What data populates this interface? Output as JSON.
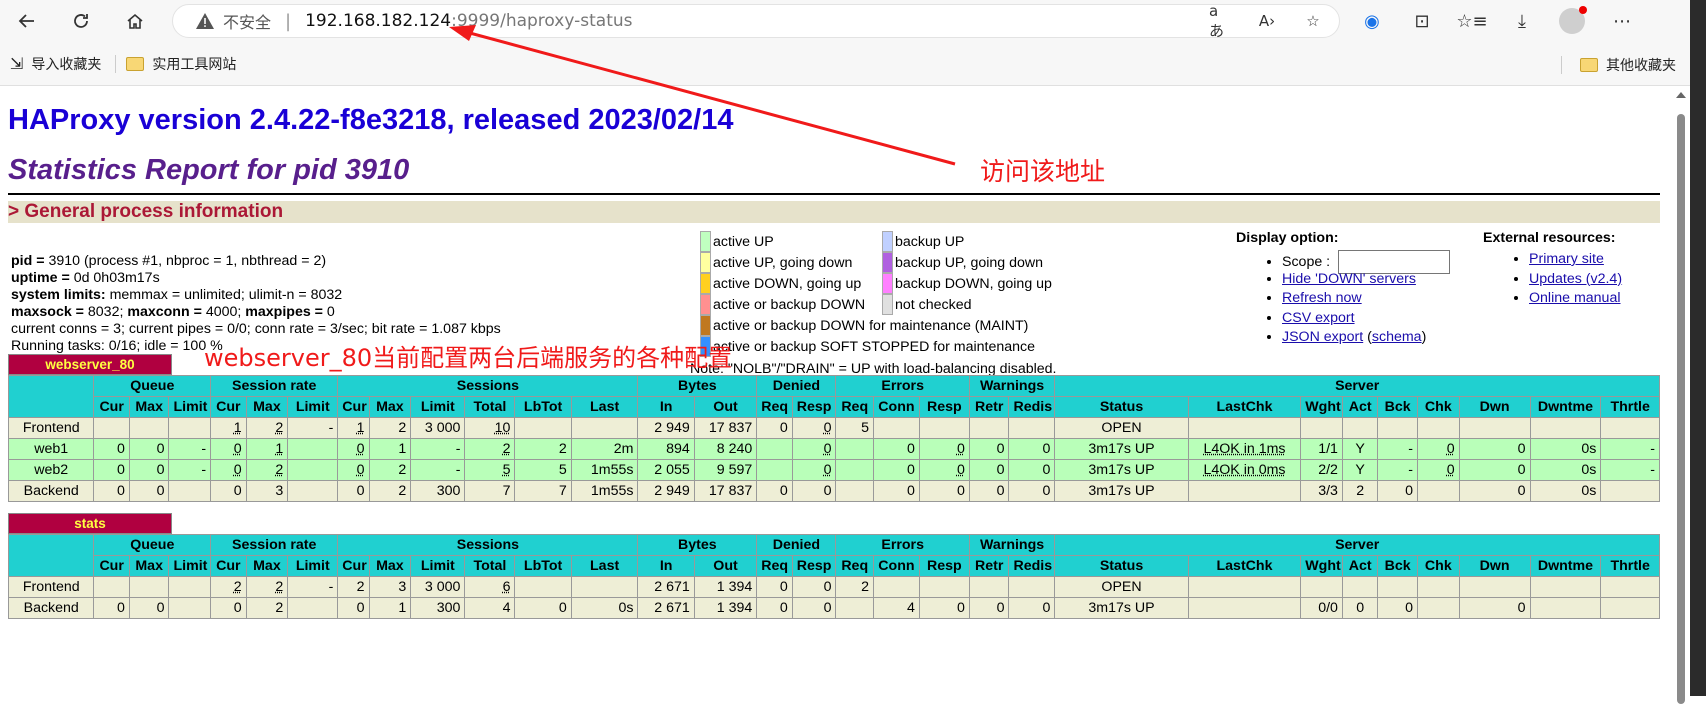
{
  "browser": {
    "insecure_label": "不安全",
    "url_host": "192.168.182.124",
    "url_rest": ":9999/haproxy-status",
    "bookmarks": [
      {
        "label": "导入收藏夹"
      },
      {
        "label": "实用工具网站"
      }
    ],
    "other_bookmarks": "其他收藏夹"
  },
  "page": {
    "title": "HAProxy version 2.4.22-f8e3218, released 2023/02/14",
    "subtitle": "Statistics Report for pid 3910",
    "section_title": "> General process information",
    "process_info": {
      "pid_label": "pid = ",
      "pid_value": "3910 (process #1, nbproc = 1, nbthread = 2)",
      "uptime_label": "uptime = ",
      "uptime_value": "0d 0h03m17s",
      "limits_label": "system limits:",
      "limits_value": " memmax = unlimited; ulimit-n = 8032",
      "maxsock_label": "maxsock = ",
      "maxsock_value": "8032; ",
      "maxconn_label": "maxconn = ",
      "maxconn_value": "4000; ",
      "maxpipes_label": "maxpipes = ",
      "maxpipes_value": "0",
      "conns_line": "current conns = 3; current pipes = 0/0; conn rate = 3/sec; bit rate = 1.087 kbps",
      "tasks_line": "Running tasks: 0/16; idle = 100 %"
    },
    "legend": {
      "items": [
        {
          "label": "active UP",
          "color": "#c0ffc0"
        },
        {
          "label": "active UP, going down",
          "color": "#ffffa0"
        },
        {
          "label": "active DOWN, going up",
          "color": "#ffd020"
        },
        {
          "label": "active or backup DOWN",
          "color": "#ff9090"
        },
        {
          "label": "active or backup DOWN for maintenance (MAINT)",
          "color": "#c07820"
        },
        {
          "label": "active or backup SOFT STOPPED for maintenance",
          "color": "#3390ff"
        },
        {
          "label": "backup UP",
          "color": "#c0d0ff"
        },
        {
          "label": "backup UP, going down",
          "color": "#b060e0"
        },
        {
          "label": "backup DOWN, going up",
          "color": "#ff80ff"
        },
        {
          "label": "not checked",
          "color": "#e0e0e0"
        }
      ],
      "note": "Note: \"NOLB\"/\"DRAIN\" = UP with load-balancing disabled."
    },
    "display_option": {
      "title": "Display option:",
      "scope_label": "Scope : ",
      "links": [
        "Hide 'DOWN' servers",
        "Refresh now",
        "CSV export",
        "JSON export"
      ],
      "schema_link": "schema"
    },
    "external_resources": {
      "title": "External resources:",
      "links": [
        "Primary site",
        "Updates (v2.4)",
        "Online manual"
      ]
    },
    "annotations": {
      "visit": "访问该地址",
      "webserver": "webserver_80当前配置两台后端服务的各种配置"
    }
  },
  "tables": {
    "group_headers": [
      "Queue",
      "Session rate",
      "Sessions",
      "Bytes",
      "Denied",
      "Errors",
      "Warnings",
      "Server"
    ],
    "columns": [
      "Cur",
      "Max",
      "Limit",
      "Cur",
      "Max",
      "Limit",
      "Cur",
      "Max",
      "Limit",
      "Total",
      "LbTot",
      "Last",
      "In",
      "Out",
      "Req",
      "Resp",
      "Req",
      "Conn",
      "Resp",
      "Retr",
      "Redis",
      "Status",
      "LastChk",
      "Wght",
      "Act",
      "Bck",
      "Chk",
      "Dwn",
      "Dwntme",
      "Thrtle"
    ],
    "webserver": {
      "name": "webserver_80",
      "rows": [
        {
          "kind": "fe",
          "cells": [
            "Frontend",
            "",
            "",
            "",
            "1",
            "2",
            "-",
            "1",
            "2",
            "3 000",
            "10",
            "",
            "",
            "2 949",
            "17 837",
            "0",
            "0",
            "5",
            "",
            "",
            "",
            "",
            "OPEN",
            "",
            "",
            "",
            "",
            "",
            "",
            "",
            ""
          ]
        },
        {
          "kind": "up",
          "cells": [
            "web1",
            "0",
            "0",
            "-",
            "0",
            "1",
            "",
            "0",
            "1",
            "-",
            "2",
            "2",
            "2m",
            "894",
            "8 240",
            "",
            "0",
            "",
            "0",
            "0",
            "0",
            "0",
            "3m17s UP",
            "L4OK in 1ms",
            "1/1",
            "Y",
            "-",
            "0",
            "0",
            "0s",
            "-"
          ]
        },
        {
          "kind": "up",
          "cells": [
            "web2",
            "0",
            "0",
            "-",
            "0",
            "2",
            "",
            "0",
            "2",
            "-",
            "5",
            "5",
            "1m55s",
            "2 055",
            "9 597",
            "",
            "0",
            "",
            "0",
            "0",
            "0",
            "0",
            "3m17s UP",
            "L4OK in 0ms",
            "2/2",
            "Y",
            "-",
            "0",
            "0",
            "0s",
            "-"
          ]
        },
        {
          "kind": "be",
          "cells": [
            "Backend",
            "0",
            "0",
            "",
            "0",
            "3",
            "",
            "0",
            "2",
            "300",
            "7",
            "7",
            "1m55s",
            "2 949",
            "17 837",
            "0",
            "0",
            "",
            "0",
            "0",
            "0",
            "0",
            "3m17s UP",
            "",
            "3/3",
            "2",
            "0",
            "",
            "0",
            "0s",
            ""
          ]
        }
      ]
    },
    "stats": {
      "name": "stats",
      "rows": [
        {
          "kind": "fe",
          "cells": [
            "Frontend",
            "",
            "",
            "",
            "2",
            "2",
            "-",
            "2",
            "3",
            "3 000",
            "6",
            "",
            "",
            "2 671",
            "1 394",
            "0",
            "0",
            "2",
            "",
            "",
            "",
            "",
            "OPEN",
            "",
            "",
            "",
            "",
            "",
            "",
            "",
            ""
          ]
        },
        {
          "kind": "be",
          "cells": [
            "Backend",
            "0",
            "0",
            "",
            "0",
            "2",
            "",
            "0",
            "1",
            "300",
            "4",
            "0",
            "0s",
            "2 671",
            "1 394",
            "0",
            "0",
            "",
            "4",
            "0",
            "0",
            "0",
            "3m17s UP",
            "",
            "0/0",
            "0",
            "0",
            "",
            "0",
            "",
            ""
          ]
        }
      ]
    }
  }
}
